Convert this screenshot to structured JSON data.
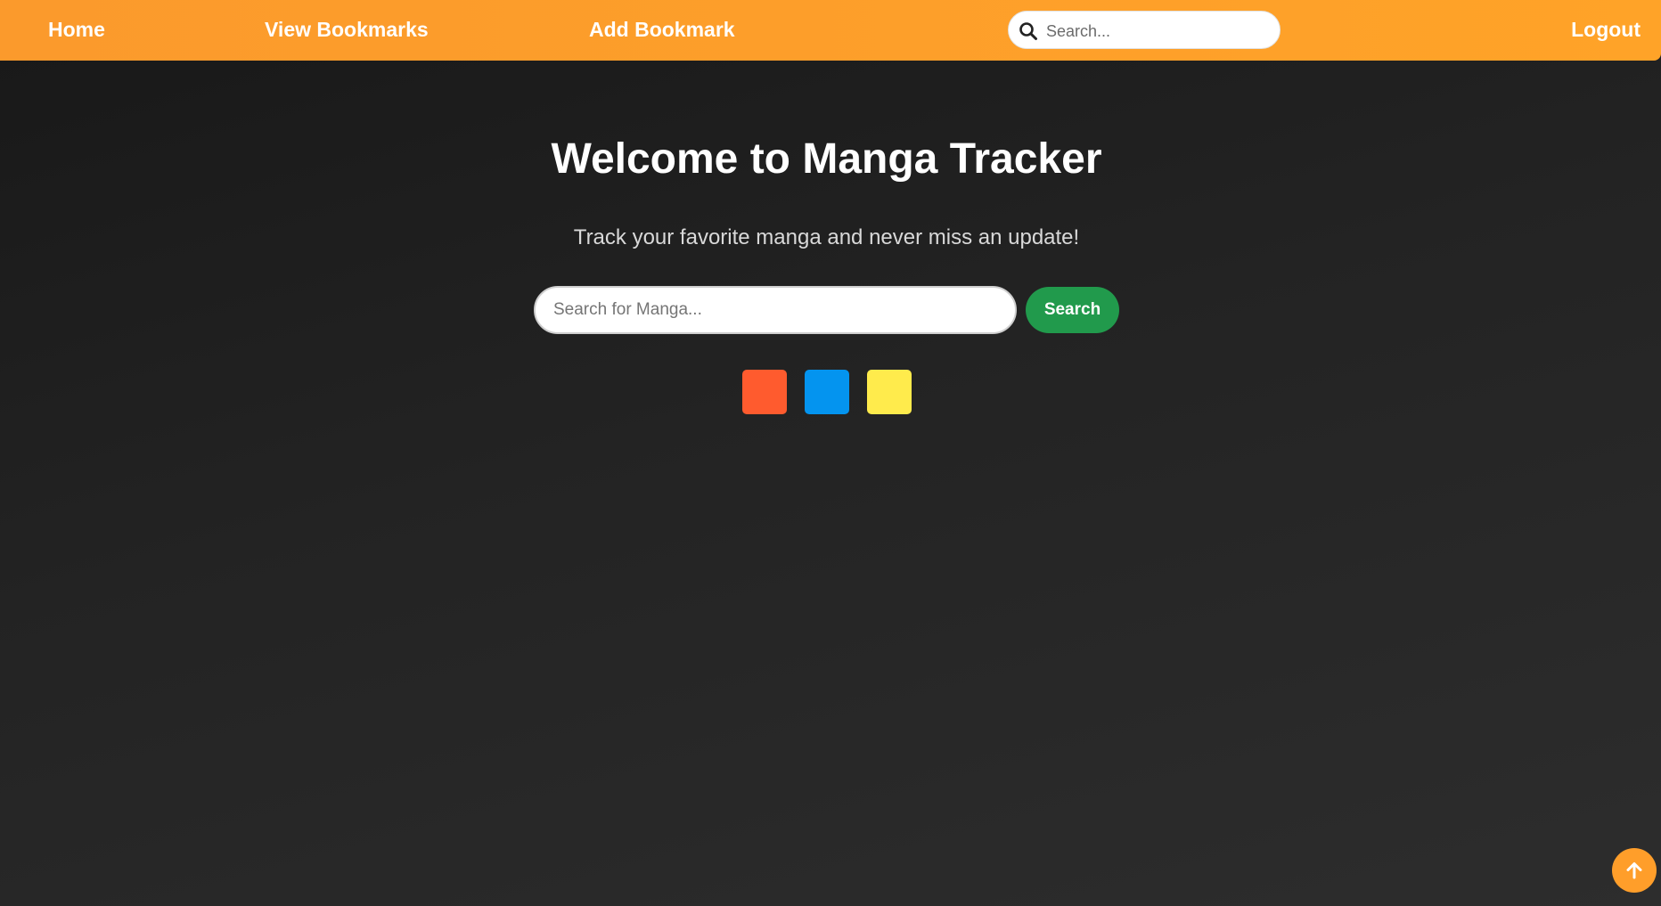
{
  "nav": {
    "home_label": "Home",
    "view_bookmarks_label": "View Bookmarks",
    "add_bookmark_label": "Add Bookmark",
    "search_placeholder": "Search...",
    "search_value": "",
    "search_icon": "search-icon",
    "logout_label": "Logout"
  },
  "hero": {
    "title": "Welcome to Manga Tracker",
    "subtitle": "Track your favorite manga and never miss an update!",
    "search_placeholder": "Search for Manga...",
    "search_value": "",
    "search_button_label": "Search"
  },
  "theme_swatches": [
    {
      "color": "#ff5b2e"
    },
    {
      "color": "#0494ef"
    },
    {
      "color": "#ffeb4c"
    }
  ],
  "back_to_top": {
    "icon": "arrow-up-icon"
  },
  "colors": {
    "accent": "#ff9e2a",
    "search_button": "#219a4c",
    "background": "#232323"
  }
}
